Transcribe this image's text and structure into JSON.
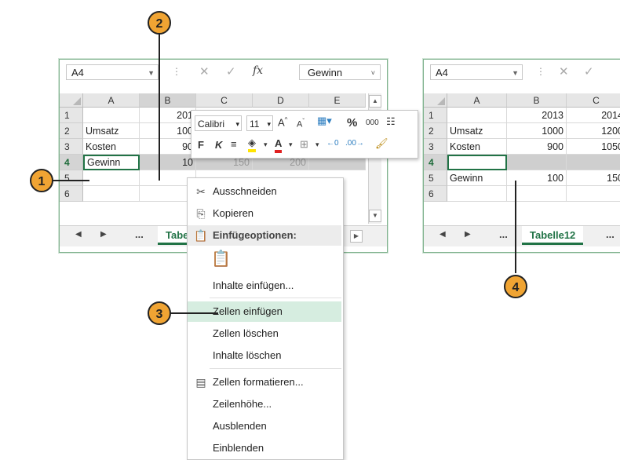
{
  "left_window": {
    "namebox": "A4",
    "formula_value": "Gewinn",
    "columns": [
      "A",
      "B",
      "C",
      "D",
      "E"
    ],
    "rows": [
      {
        "num": "1",
        "cells": [
          "",
          "201",
          "",
          "",
          ""
        ]
      },
      {
        "num": "2",
        "cells": [
          "Umsatz",
          "100",
          "",
          "",
          ""
        ]
      },
      {
        "num": "3",
        "cells": [
          "Kosten",
          "90",
          "",
          "",
          ""
        ]
      },
      {
        "num": "4",
        "cells": [
          "Gewinn",
          "10",
          "150",
          "200",
          ""
        ]
      },
      {
        "num": "5",
        "cells": [
          "",
          "",
          "",
          "",
          ""
        ]
      },
      {
        "num": "6",
        "cells": [
          "",
          "",
          "",
          "",
          ""
        ]
      }
    ],
    "sheet_tab": "Tabe",
    "ellipsis": "..."
  },
  "mini_toolbar": {
    "font": "Calibri",
    "size": "11",
    "bold": "F",
    "italic": "K",
    "percent": "%",
    "thousands": "000"
  },
  "context_menu": {
    "items": [
      {
        "label": "Ausschneiden",
        "icon": "scissors-icon"
      },
      {
        "label": "Kopieren",
        "icon": "copy-icon"
      },
      {
        "label": "Einfügeoptionen:",
        "icon": "paste-icon"
      },
      {
        "label": "Inhalte einfügen...",
        "icon": ""
      },
      {
        "label": "Zellen einfügen",
        "icon": ""
      },
      {
        "label": "Zellen löschen",
        "icon": ""
      },
      {
        "label": "Inhalte löschen",
        "icon": ""
      },
      {
        "label": "Zellen formatieren...",
        "icon": "format-cells-icon"
      },
      {
        "label": "Zeilenhöhe...",
        "icon": ""
      },
      {
        "label": "Ausblenden",
        "icon": ""
      },
      {
        "label": "Einblenden",
        "icon": ""
      }
    ]
  },
  "right_window": {
    "namebox": "A4",
    "columns": [
      "A",
      "B",
      "C"
    ],
    "rows": [
      {
        "num": "1",
        "cells": [
          "",
          "2013",
          "2014"
        ]
      },
      {
        "num": "2",
        "cells": [
          "Umsatz",
          "1000",
          "1200"
        ]
      },
      {
        "num": "3",
        "cells": [
          "Kosten",
          "900",
          "1050"
        ]
      },
      {
        "num": "4",
        "cells": [
          "",
          "",
          ""
        ]
      },
      {
        "num": "5",
        "cells": [
          "Gewinn",
          "100",
          "150"
        ]
      },
      {
        "num": "6",
        "cells": [
          "",
          "",
          ""
        ]
      }
    ],
    "sheet_tab": "Tabelle12",
    "ellipsis": "..."
  },
  "callouts": [
    "1",
    "2",
    "3",
    "4"
  ],
  "colors": {
    "accent": "#217346",
    "highlight": "#d6ede0",
    "callout": "#f0a433"
  }
}
